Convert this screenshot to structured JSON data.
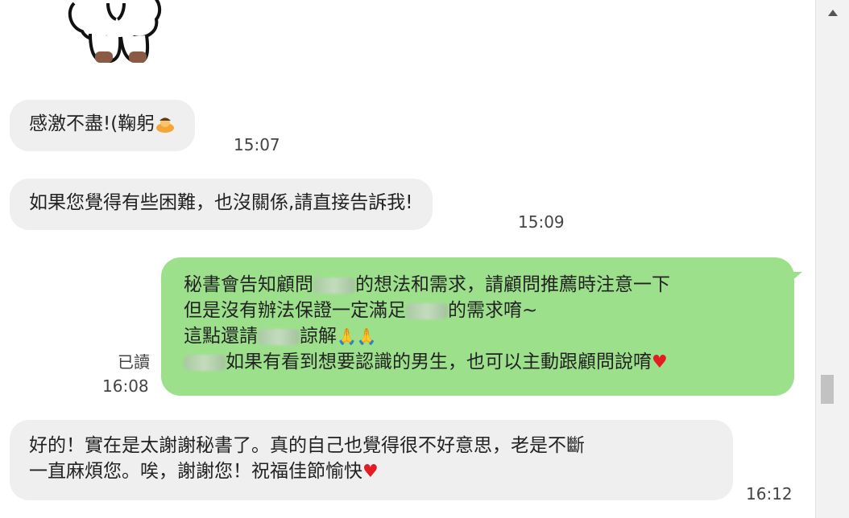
{
  "messages": [
    {
      "text": "感激不盡!(鞠躬",
      "time": "15:07"
    },
    {
      "text": "如果您覺得有些困難，也沒關係,請直接告訴我!",
      "time": "15:09"
    },
    {
      "line1a": "秘書會告知顧問",
      "line1b": "的想法和需求，請顧問推薦時注意一下",
      "line2a": "但是沒有辦法保證一定滿足",
      "line2b": "的需求唷~",
      "line3a": "這點還請",
      "line3b": "諒解",
      "line4b": "如果有看到想要認識的男生，也可以主動跟顧問說唷",
      "read": "已讀",
      "time": "16:08"
    },
    {
      "line1": "好的！實在是太謝謝秘書了。真的自己也覺得很不好意思，老是不斷",
      "line2": "一直麻煩您。唉，謝謝您！祝福佳節愉快",
      "time": "16:12"
    }
  ],
  "icons": [
    "sticker-sheep",
    "bowing-emoji",
    "praying-hands-emoji",
    "heart-emoji",
    "scroll-up-arrow"
  ],
  "colors": {
    "incoming_bubble": "#efefef",
    "outgoing_bubble": "#9de08c",
    "heart": "#e31b23"
  }
}
